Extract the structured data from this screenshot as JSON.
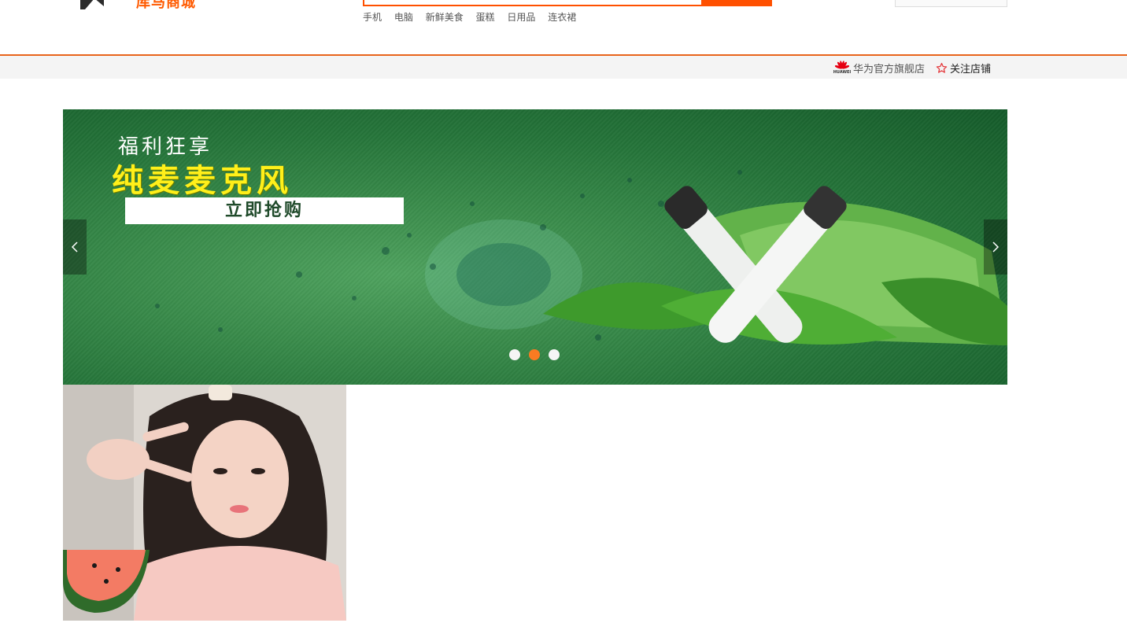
{
  "header": {
    "logo_text": "库马商城",
    "hot_words": [
      "手机",
      "电脑",
      "新鲜美食",
      "蛋糕",
      "日用品",
      "连衣裙"
    ]
  },
  "shop_bar": {
    "brand_logo_text": "HUAWEI",
    "shop_name": "华为官方旗舰店",
    "follow_label": "关注店铺",
    "accent_color": "#e8641b"
  },
  "banner": {
    "line1": "福利狂享",
    "line2": "纯麦麦克风",
    "cta": "立即抢购",
    "slide_count": 3,
    "active_slide": 2,
    "active_dot_color": "#f97b22"
  },
  "icons": {
    "prev": "chevron-left-icon",
    "next": "chevron-right-icon",
    "follow": "star-outline-icon",
    "brand": "huawei-logo-icon"
  },
  "colors": {
    "brand_orange": "#ff5000",
    "banner_green": "#2e7f3f",
    "cta_yellow": "#ffef1a"
  }
}
